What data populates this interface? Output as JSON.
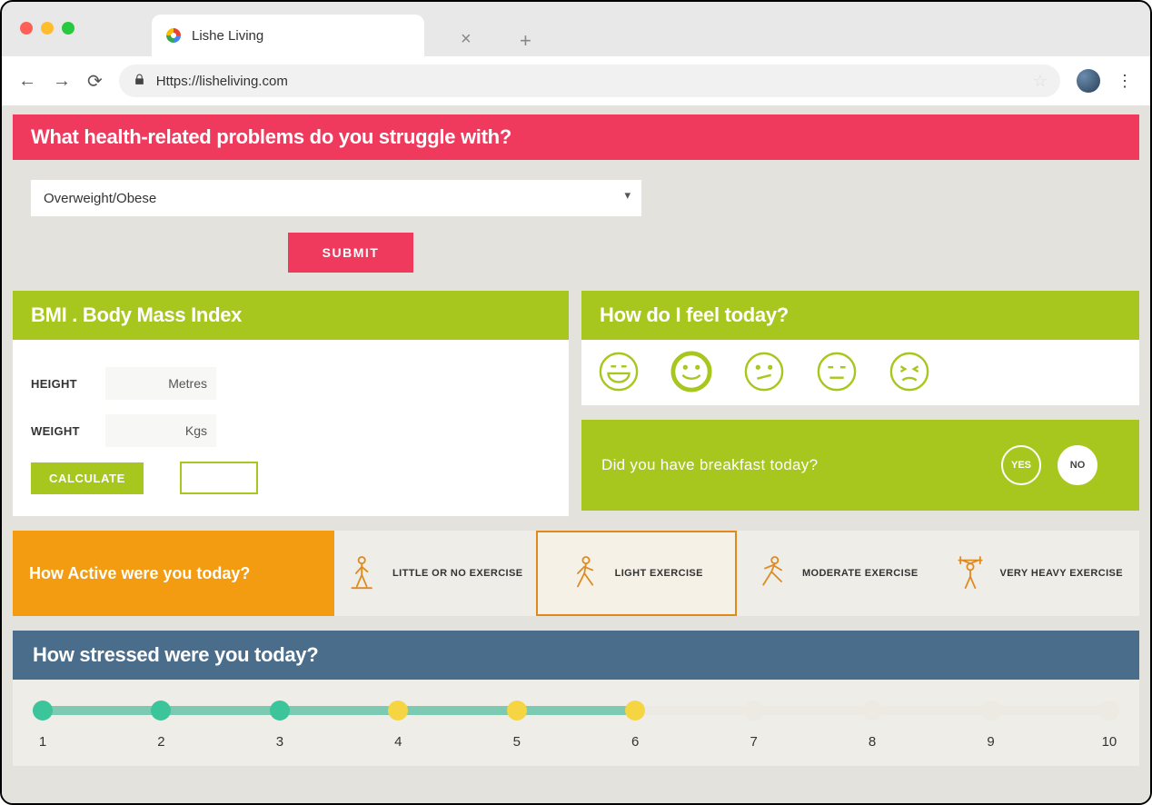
{
  "browser": {
    "tab_title": "Lishe Living",
    "url": "Https://lisheliving.com"
  },
  "health_section": {
    "heading": "What health-related problems do you struggle with?",
    "selected_option": "Overweight/Obese",
    "submit_label": "SUBMIT"
  },
  "bmi_section": {
    "heading": "BMI . Body Mass Index",
    "height_label": "HEIGHT",
    "height_placeholder": "Metres",
    "weight_label": "WEIGHT",
    "weight_placeholder": "Kgs",
    "calculate_label": "CALCULATE"
  },
  "mood_section": {
    "heading": "How do I feel today?",
    "selected_index": 1
  },
  "breakfast_section": {
    "question": "Did you have breakfast today?",
    "yes_label": "YES",
    "no_label": "NO"
  },
  "activity_section": {
    "heading": "How Active were you today?",
    "options": [
      "LITTLE OR NO EXERCISE",
      "LIGHT  EXERCISE",
      "MODERATE  EXERCISE",
      "VERY HEAVY  EXERCISE"
    ],
    "selected_index": 1
  },
  "stress_section": {
    "heading": "How stressed were you today?",
    "labels": [
      "1",
      "2",
      "3",
      "4",
      "5",
      "6",
      "7",
      "8",
      "9",
      "10"
    ],
    "fill_percent": 56,
    "dot_states": [
      "green",
      "green",
      "green",
      "yellow",
      "yellow",
      "yellow",
      "grey",
      "grey",
      "grey",
      "grey"
    ]
  }
}
